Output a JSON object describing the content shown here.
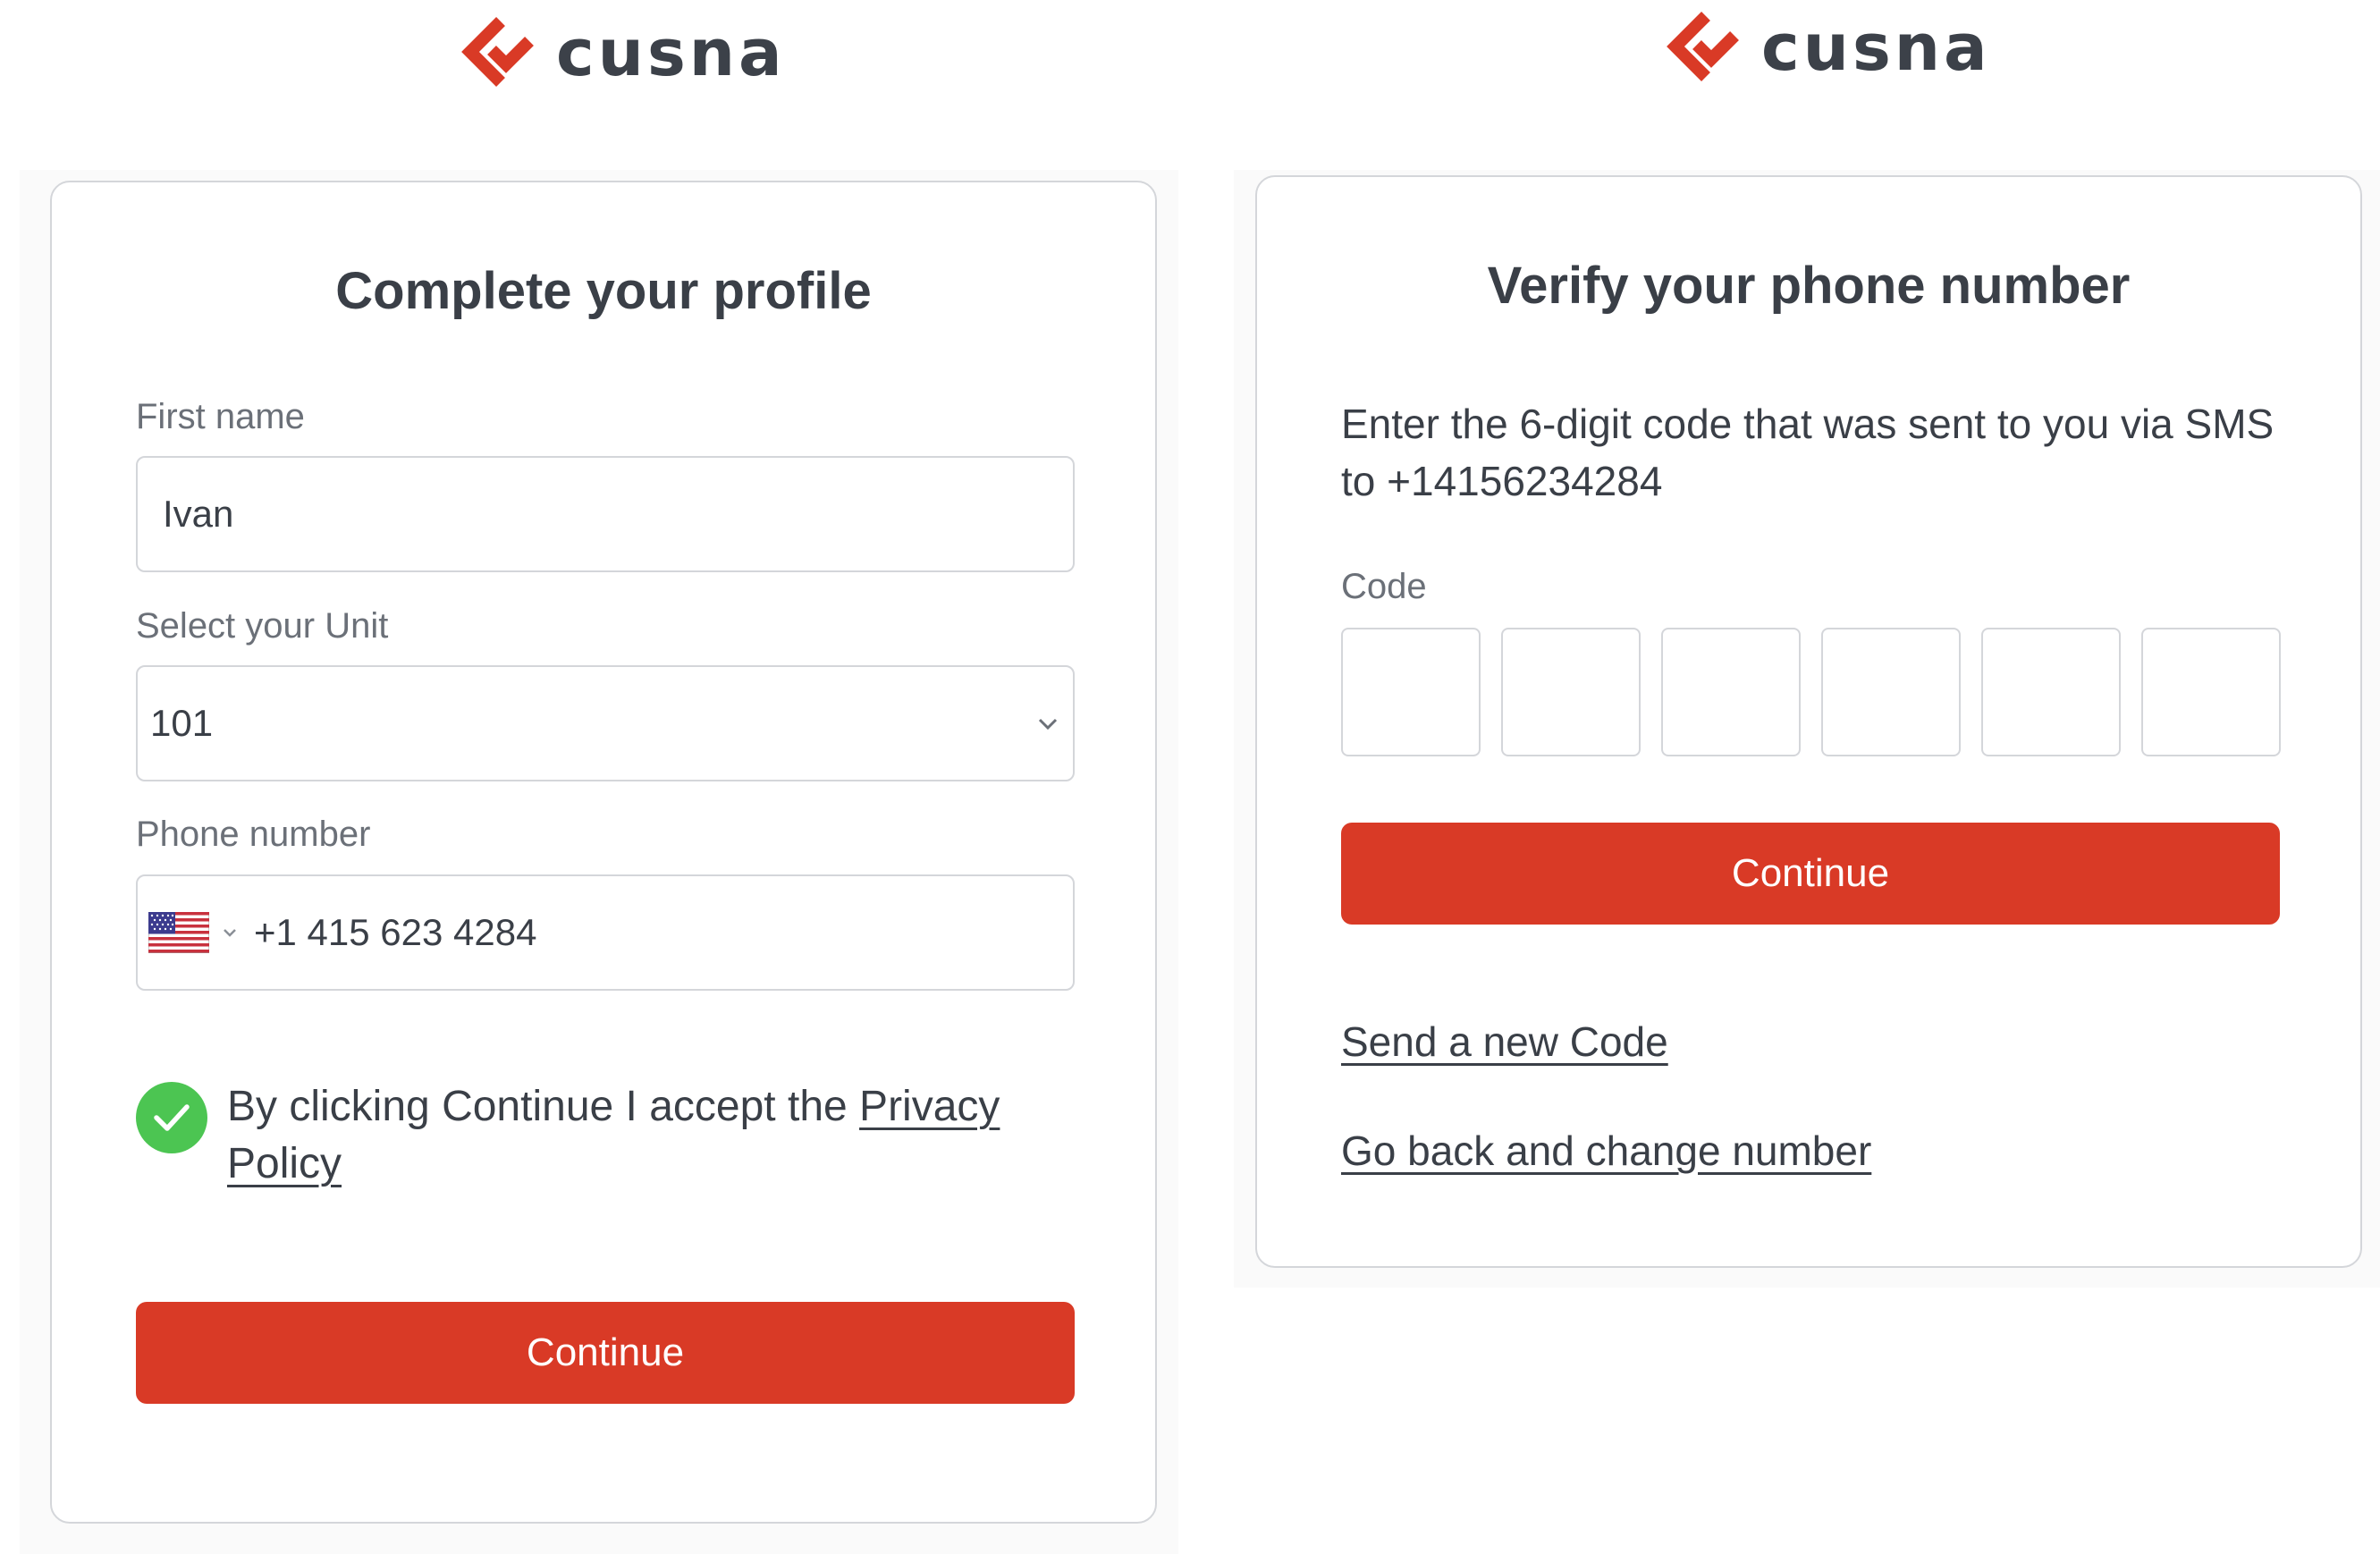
{
  "brand": {
    "name": "cusna",
    "accent": "#d93a26"
  },
  "profile": {
    "title": "Complete your profile",
    "first_name": {
      "label": "First name",
      "value": "Ivan"
    },
    "unit": {
      "label": "Select your Unit",
      "value": "101",
      "icon": "chevron-down-icon"
    },
    "phone": {
      "label": "Phone number",
      "country_icon": "us-flag-icon",
      "value": "+1 415 623 4284"
    },
    "consent": {
      "checked": true,
      "text": "By clicking Continue I accept the ",
      "link": "Privacy Policy"
    },
    "continue_label": "Continue"
  },
  "verify": {
    "title": "Verify your phone number",
    "description": "Enter the 6-digit code that was sent to you via SMS to +14156234284",
    "code_label": "Code",
    "code_digits": [
      "",
      "",
      "",
      "",
      "",
      ""
    ],
    "continue_label": "Continue",
    "resend_link": "Send a new Code",
    "change_number_link": "Go back and change number"
  }
}
